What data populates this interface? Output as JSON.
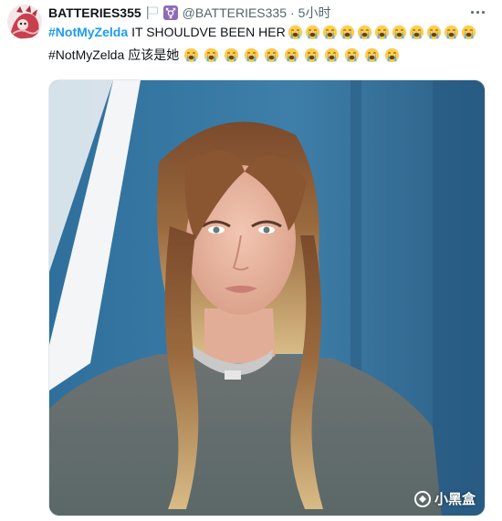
{
  "tweet": {
    "display_name": "BATTERIES355",
    "handle": "@BATTERIES335",
    "separator": "·",
    "time": "5小时",
    "line1": {
      "hashtag": "#NotMyZelda",
      "text": "IT SHOULDVE BEEN HER",
      "emoji_count": 11
    },
    "line2": {
      "hashtag": "#NotMyZelda",
      "text": "应该是她",
      "emoji_count": 11
    },
    "icons": {
      "avatar": "avatar-illustration",
      "flag": "white-flag-icon",
      "badge": "transgender-symbol-icon",
      "emoji": "loudly-crying-face-emoji",
      "more": "more-dots-icon",
      "watermark": "xiaoheihe-logo-icon"
    },
    "colors": {
      "hashtag": "#1d9bf0",
      "secondary_text": "#536471",
      "badge": "#8e6bb8"
    }
  },
  "media": {
    "watermark_text": "小黑盒"
  }
}
